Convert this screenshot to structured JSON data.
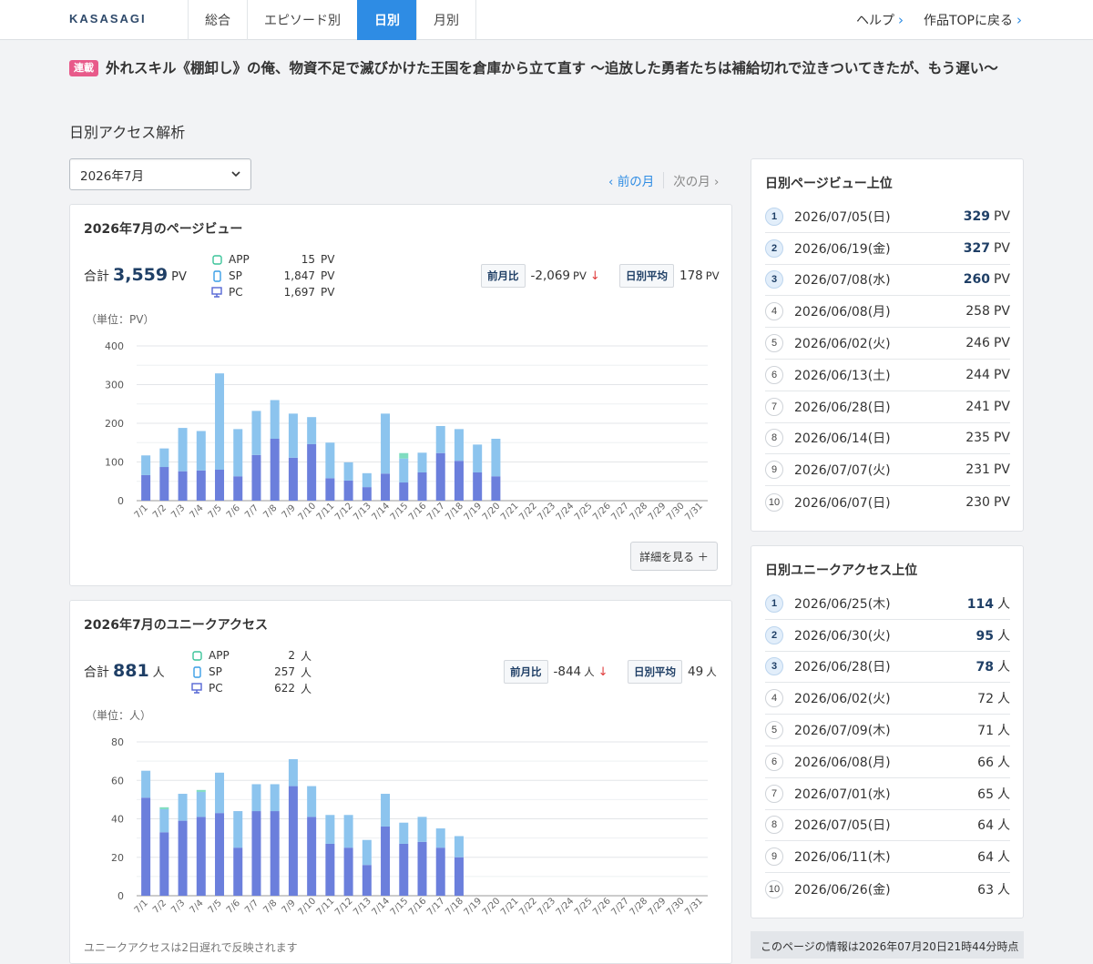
{
  "header": {
    "logo": "KASASAGI",
    "tabs": [
      {
        "label": "総合",
        "active": false
      },
      {
        "label": "エピソード別",
        "active": false
      },
      {
        "label": "日別",
        "active": true
      },
      {
        "label": "月別",
        "active": false
      }
    ],
    "help_label": "ヘルプ",
    "back_label": "作品TOPに戻る"
  },
  "work": {
    "badge": "連載",
    "title": "外れスキル《棚卸し》の俺、物資不足で滅びかけた王国を倉庫から立て直す 〜追放した勇者たちは補給切れで泣きついてきたが、もう遅い〜"
  },
  "section_title": "日別アクセス解析",
  "month_select": {
    "value": "2026年7月"
  },
  "month_nav": {
    "prev": "前の月",
    "next": "次の月"
  },
  "pageview": {
    "title": "2026年7月のページビュー",
    "total_label": "合計",
    "total": "3,559",
    "unit": "PV",
    "devices": [
      {
        "name": "APP",
        "value": "15",
        "unit": "PV",
        "icon": "app-icon"
      },
      {
        "name": "SP",
        "value": "1,847",
        "unit": "PV",
        "icon": "smartphone-icon"
      },
      {
        "name": "PC",
        "value": "1,697",
        "unit": "PV",
        "icon": "pc-icon"
      }
    ],
    "mom_label": "前月比",
    "mom_value": "-2,069",
    "avg_label": "日別平均",
    "avg_value": "178",
    "unit_note": "（単位：PV）",
    "detail_button": "詳細を見る ＋"
  },
  "unique": {
    "title": "2026年7月のユニークアクセス",
    "total_label": "合計",
    "total": "881",
    "unit": "人",
    "devices": [
      {
        "name": "APP",
        "value": "2",
        "unit": "人",
        "icon": "app-icon"
      },
      {
        "name": "SP",
        "value": "257",
        "unit": "人",
        "icon": "smartphone-icon"
      },
      {
        "name": "PC",
        "value": "622",
        "unit": "人",
        "icon": "pc-icon"
      }
    ],
    "mom_label": "前月比",
    "mom_value": "-844",
    "avg_label": "日別平均",
    "avg_value": "49",
    "unit_note": "（単位：人）",
    "footnote": "ユニークアクセスは2日遅れで反映されます"
  },
  "chart_data": [
    {
      "type": "bar",
      "stacked": true,
      "categories": [
        "7/1",
        "7/2",
        "7/3",
        "7/4",
        "7/5",
        "7/6",
        "7/7",
        "7/8",
        "7/9",
        "7/10",
        "7/11",
        "7/12",
        "7/13",
        "7/14",
        "7/15",
        "7/16",
        "7/17",
        "7/18",
        "7/19",
        "7/20",
        "7/21",
        "7/22",
        "7/23",
        "7/24",
        "7/25",
        "7/26",
        "7/27",
        "7/28",
        "7/29",
        "7/30",
        "7/31"
      ],
      "series": [
        {
          "name": "PC",
          "color": "#6b7fdc",
          "values": [
            66,
            87,
            76,
            78,
            80,
            63,
            118,
            160,
            111,
            146,
            58,
            52,
            35,
            70,
            47,
            73,
            123,
            103,
            73,
            63,
            0,
            0,
            0,
            0,
            0,
            0,
            0,
            0,
            0,
            0,
            0
          ]
        },
        {
          "name": "SP",
          "color": "#8cc4ee",
          "values": [
            51,
            48,
            112,
            102,
            249,
            122,
            114,
            100,
            114,
            70,
            92,
            47,
            36,
            155,
            62,
            51,
            70,
            82,
            72,
            97,
            0,
            0,
            0,
            0,
            0,
            0,
            0,
            0,
            0,
            0,
            0
          ]
        },
        {
          "name": "APP",
          "color": "#7fdcc0",
          "values": [
            0,
            0,
            0,
            0,
            0,
            0,
            0,
            0,
            0,
            0,
            0,
            0,
            0,
            0,
            14,
            0,
            0,
            0,
            0,
            0,
            0,
            0,
            0,
            0,
            0,
            0,
            0,
            0,
            0,
            0,
            0
          ]
        }
      ],
      "ylim": [
        0,
        400
      ],
      "yticks": [
        0,
        100,
        200,
        300,
        400
      ],
      "grid": true
    },
    {
      "type": "bar",
      "stacked": true,
      "categories": [
        "7/1",
        "7/2",
        "7/3",
        "7/4",
        "7/5",
        "7/6",
        "7/7",
        "7/8",
        "7/9",
        "7/10",
        "7/11",
        "7/12",
        "7/13",
        "7/14",
        "7/15",
        "7/16",
        "7/17",
        "7/18",
        "7/19",
        "7/20",
        "7/21",
        "7/22",
        "7/23",
        "7/24",
        "7/25",
        "7/26",
        "7/27",
        "7/28",
        "7/29",
        "7/30",
        "7/31"
      ],
      "series": [
        {
          "name": "PC",
          "color": "#6b7fdc",
          "values": [
            51,
            33,
            39,
            41,
            43,
            25,
            44,
            44,
            57,
            41,
            27,
            25,
            16,
            36,
            27,
            28,
            25,
            20,
            0,
            0,
            0,
            0,
            0,
            0,
            0,
            0,
            0,
            0,
            0,
            0,
            0
          ]
        },
        {
          "name": "SP",
          "color": "#8cc4ee",
          "values": [
            14,
            12,
            14,
            13,
            21,
            19,
            14,
            14,
            14,
            16,
            15,
            17,
            13,
            17,
            11,
            13,
            10,
            11,
            0,
            0,
            0,
            0,
            0,
            0,
            0,
            0,
            0,
            0,
            0,
            0,
            0
          ]
        },
        {
          "name": "APP",
          "color": "#7fdcc0",
          "values": [
            0,
            1,
            0,
            1,
            0,
            0,
            0,
            0,
            0,
            0,
            0,
            0,
            0,
            0,
            0,
            0,
            0,
            0,
            0,
            0,
            0,
            0,
            0,
            0,
            0,
            0,
            0,
            0,
            0,
            0,
            0
          ]
        }
      ],
      "ylim": [
        0,
        80
      ],
      "yticks": [
        0,
        20,
        40,
        60,
        80
      ],
      "grid": true
    }
  ],
  "pv_ranking": {
    "title": "日別ページビュー上位",
    "unit": "PV",
    "items": [
      {
        "rank": "1",
        "date": "2026/07/05(日)",
        "value": "329"
      },
      {
        "rank": "2",
        "date": "2026/06/19(金)",
        "value": "327"
      },
      {
        "rank": "3",
        "date": "2026/07/08(水)",
        "value": "260"
      },
      {
        "rank": "4",
        "date": "2026/06/08(月)",
        "value": "258"
      },
      {
        "rank": "5",
        "date": "2026/06/02(火)",
        "value": "246"
      },
      {
        "rank": "6",
        "date": "2026/06/13(土)",
        "value": "244"
      },
      {
        "rank": "7",
        "date": "2026/06/28(日)",
        "value": "241"
      },
      {
        "rank": "8",
        "date": "2026/06/14(日)",
        "value": "235"
      },
      {
        "rank": "9",
        "date": "2026/07/07(火)",
        "value": "231"
      },
      {
        "rank": "10",
        "date": "2026/06/07(日)",
        "value": "230"
      }
    ]
  },
  "ua_ranking": {
    "title": "日別ユニークアクセス上位",
    "unit": "人",
    "items": [
      {
        "rank": "1",
        "date": "2026/06/25(木)",
        "value": "114"
      },
      {
        "rank": "2",
        "date": "2026/06/30(火)",
        "value": "95"
      },
      {
        "rank": "3",
        "date": "2026/06/28(日)",
        "value": "78"
      },
      {
        "rank": "4",
        "date": "2026/06/02(火)",
        "value": "72"
      },
      {
        "rank": "5",
        "date": "2026/07/09(木)",
        "value": "71"
      },
      {
        "rank": "6",
        "date": "2026/06/08(月)",
        "value": "66"
      },
      {
        "rank": "7",
        "date": "2026/07/01(水)",
        "value": "65"
      },
      {
        "rank": "8",
        "date": "2026/07/05(日)",
        "value": "64"
      },
      {
        "rank": "9",
        "date": "2026/06/11(木)",
        "value": "64"
      },
      {
        "rank": "10",
        "date": "2026/06/26(金)",
        "value": "63"
      }
    ]
  },
  "info_stamp": "このページの情報は2026年07月20日21時44分時点"
}
